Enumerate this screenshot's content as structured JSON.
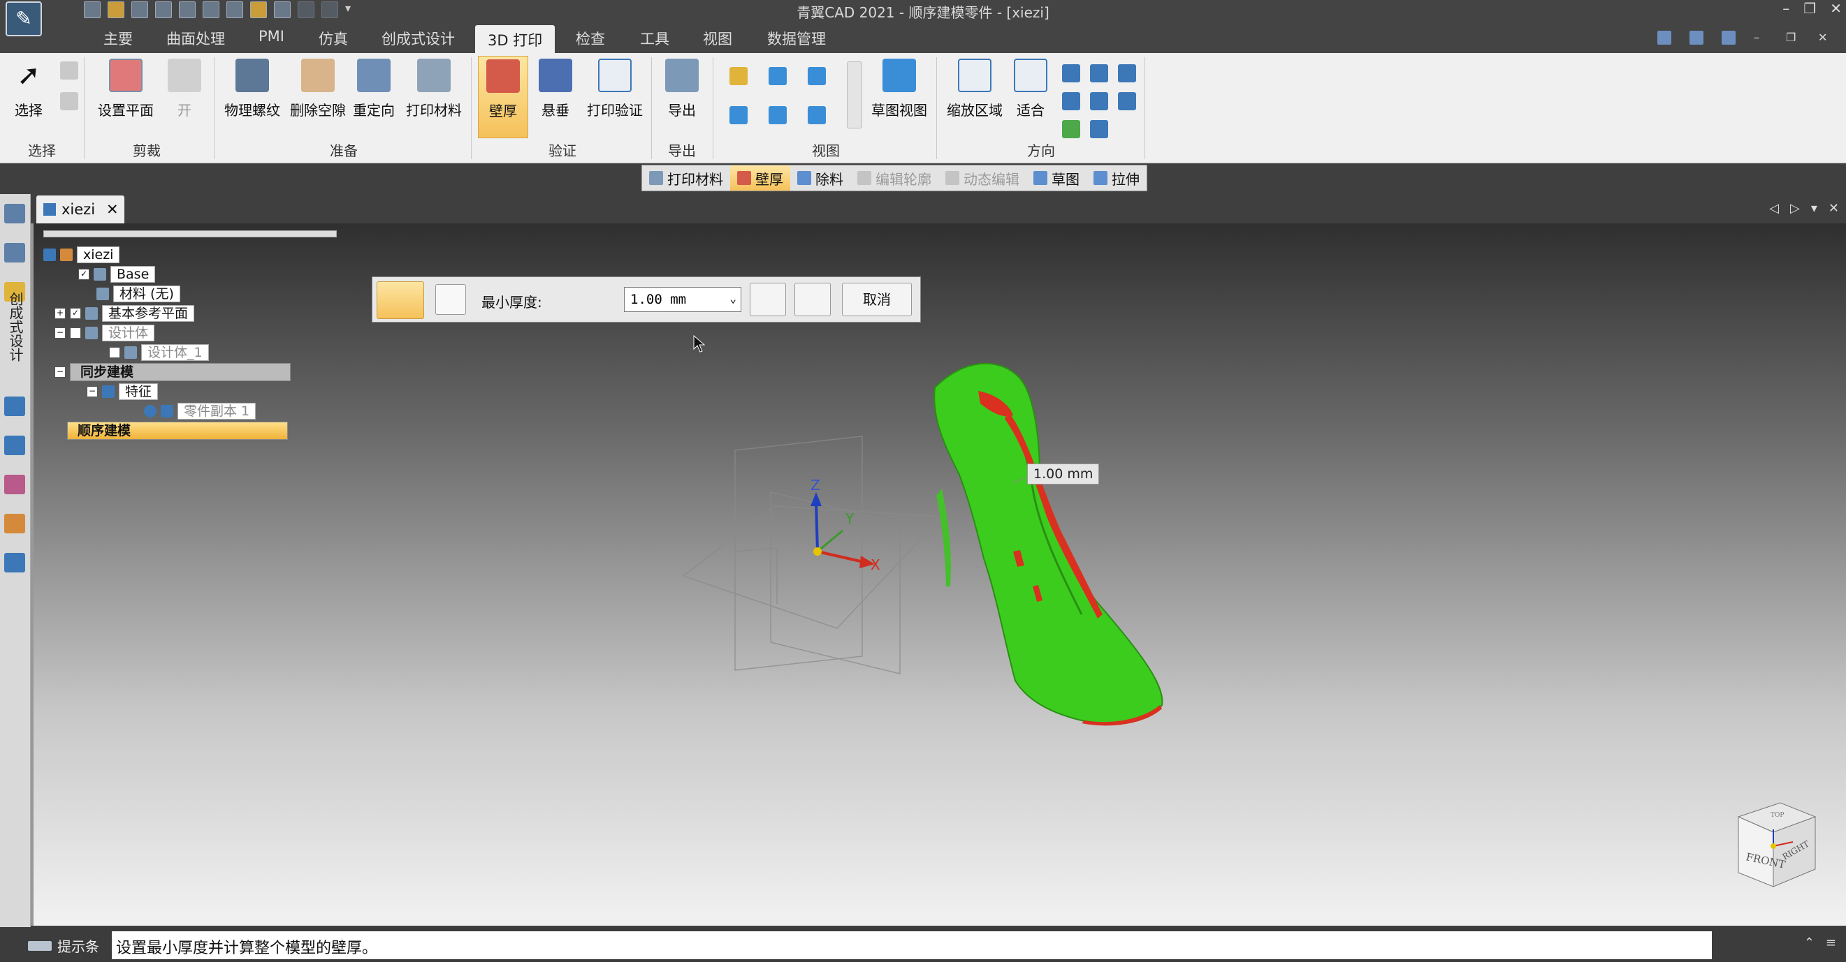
{
  "window": {
    "title": "青翼CAD 2021 - 顺序建模零件 - [xiezi]",
    "controls": [
      "–",
      "❐",
      "✕"
    ]
  },
  "ribbon_tabs": [
    "主要",
    "曲面处理",
    "PMI",
    "仿真",
    "创成式设计",
    "3D 打印",
    "检查",
    "工具",
    "视图",
    "数据管理"
  ],
  "active_tab": "3D 打印",
  "ribbon": {
    "select": {
      "label": "选择",
      "group": "选择"
    },
    "set_plane": {
      "label": "设置平面",
      "open": "开",
      "group": "剪裁"
    },
    "prepare": {
      "buttons": [
        "物理螺纹",
        "删除空隙",
        "重定向",
        "打印材料"
      ],
      "group": "准备"
    },
    "verify": {
      "buttons": [
        "壁厚",
        "悬垂",
        "打印验证"
      ],
      "group": "验证"
    },
    "export": {
      "label": "导出",
      "group": "导出"
    },
    "view": {
      "sketch_view": "草图视图",
      "group": "视图"
    },
    "orient": {
      "zoom_area": "缩放区域",
      "fit": "适合",
      "group": "方向"
    }
  },
  "command_bar": [
    {
      "label": "打印材料",
      "state": "normal"
    },
    {
      "label": "壁厚",
      "state": "active"
    },
    {
      "label": "除料",
      "state": "normal"
    },
    {
      "label": "编辑轮廓",
      "state": "disabled"
    },
    {
      "label": "动态编辑",
      "state": "disabled"
    },
    {
      "label": "草图",
      "state": "normal"
    },
    {
      "label": "拉伸",
      "state": "normal"
    }
  ],
  "left_toolbar": {
    "vertical_label": "创成式设计"
  },
  "document_tab": {
    "name": "xiezi",
    "close": "✕"
  },
  "nav_arrows": [
    "◁",
    "▷",
    "▾",
    "✕"
  ],
  "pathfinder": {
    "root": "xiezi",
    "items": [
      {
        "label": "Base",
        "checked": true,
        "dim": false
      },
      {
        "label": "材料 (无)",
        "checked": null,
        "dim": false
      },
      {
        "label": "基本参考平面",
        "checked": true,
        "dim": false
      },
      {
        "label": "设计体",
        "checked": false,
        "dim": true
      },
      {
        "label": "设计体_1",
        "checked": false,
        "dim": true
      }
    ],
    "sync_modeling": "同步建模",
    "features": "特征",
    "part_copy": "零件副本 1",
    "ordered_modeling": "顺序建模"
  },
  "command_dialog": {
    "min_thickness_label": "最小厚度:",
    "min_thickness_value": "1.00 mm",
    "cancel": "取消"
  },
  "thickness_tag": "1.00 mm",
  "axis_labels": {
    "z": "Z",
    "y": "Y",
    "x": "X"
  },
  "view_cube": {
    "front": "FRONT",
    "right": "RIGHT",
    "top": "TOP"
  },
  "status": {
    "label": "提示条",
    "text": "设置最小厚度并计算整个模型的壁厚。"
  },
  "colors": {
    "model_green": "#3ccc1e",
    "thin_red": "#d9301f",
    "highlight": "#f6c15a",
    "ui_dark": "#444444"
  }
}
